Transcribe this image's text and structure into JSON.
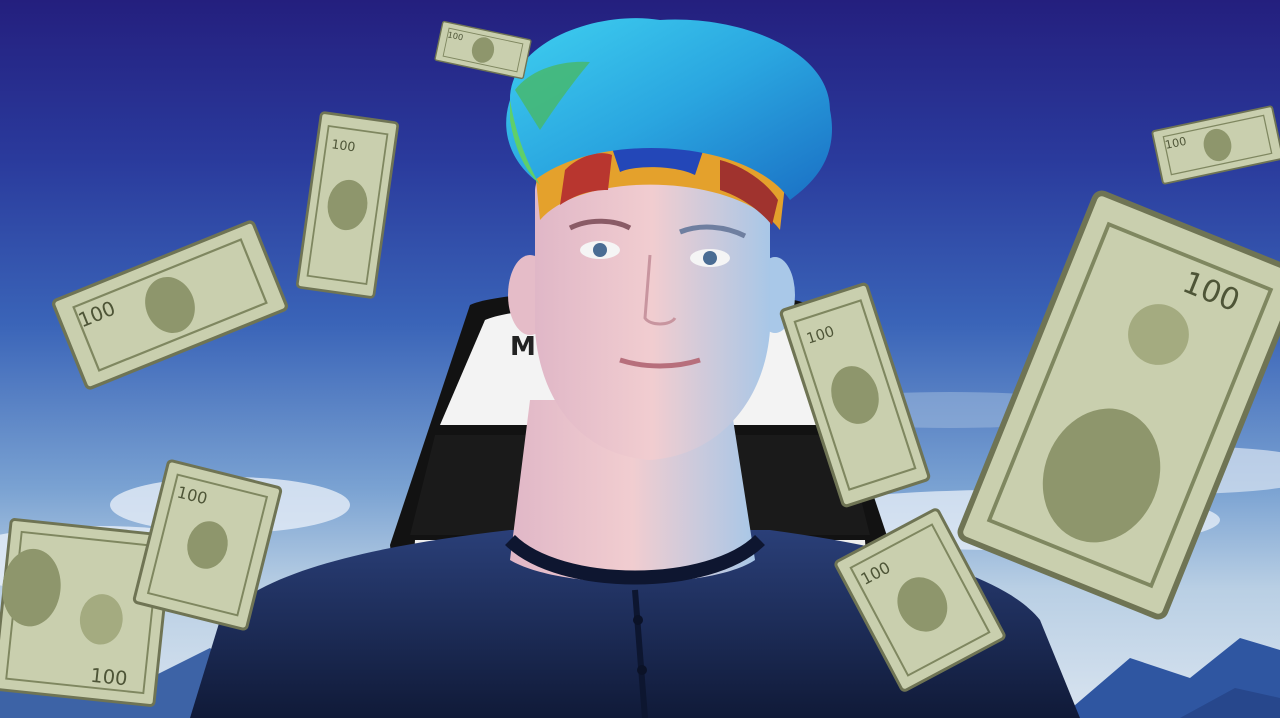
{
  "image": {
    "subject": "person-with-blue-hair-and-headband",
    "colors": {
      "sky_top": "#241f7e",
      "sky_bottom": "#d9e4f0",
      "hair": "#2fb6e6",
      "shirt": "#1b2a55",
      "bill": "#c9cfae"
    },
    "bills": [
      {
        "denomination": "100"
      },
      {
        "denomination": "100"
      },
      {
        "denomination": "100"
      },
      {
        "denomination": "100"
      },
      {
        "denomination": "100"
      },
      {
        "denomination": "100"
      },
      {
        "denomination": "100"
      },
      {
        "denomination": "100"
      },
      {
        "denomination": "100"
      }
    ]
  }
}
